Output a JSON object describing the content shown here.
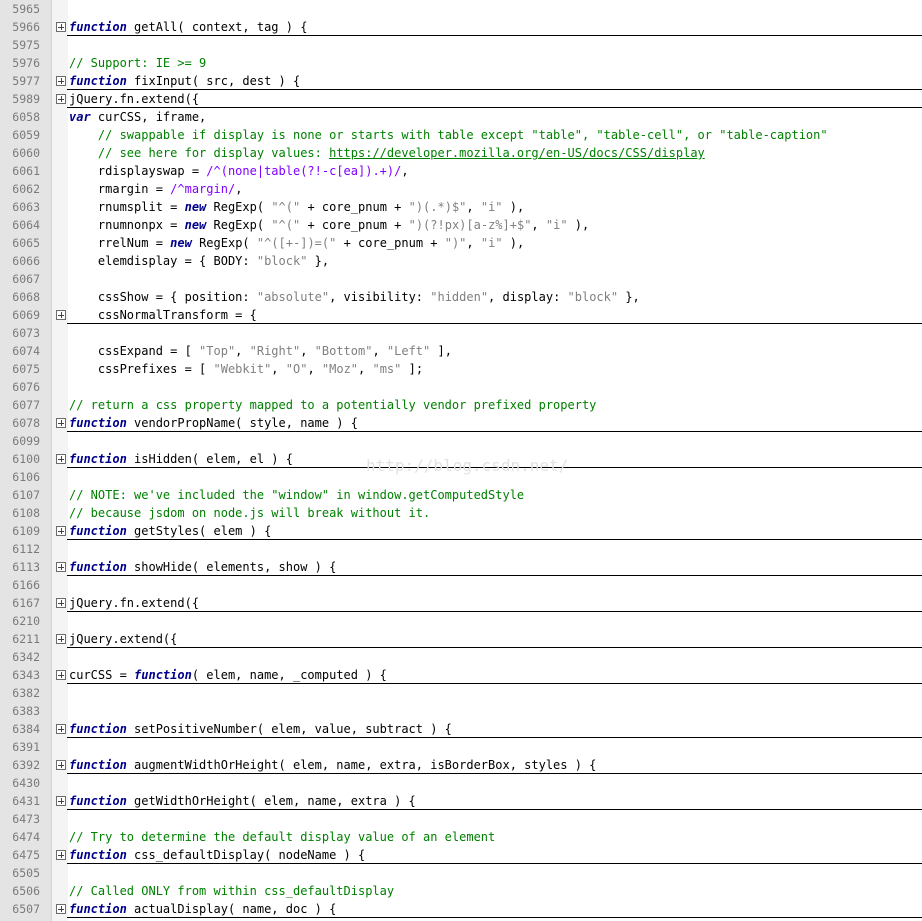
{
  "editor": {
    "watermark": "http://blog.csdn.net/",
    "lines": [
      {
        "n": "5965",
        "fold": false,
        "u": false,
        "code": ""
      },
      {
        "n": "5966",
        "fold": true,
        "u": true,
        "code": "<k>function</k> getAll( context, tag ) {"
      },
      {
        "n": "5975",
        "fold": false,
        "u": false,
        "code": ""
      },
      {
        "n": "5976",
        "fold": false,
        "u": false,
        "code": "<c>// Support: IE >= 9</c>"
      },
      {
        "n": "5977",
        "fold": true,
        "u": true,
        "code": "<k>function</k> fixInput( src, dest ) {"
      },
      {
        "n": "5989",
        "fold": true,
        "u": true,
        "code": "jQuery.fn.extend({"
      },
      {
        "n": "6058",
        "fold": false,
        "u": false,
        "code": "<k>var</k> curCSS, iframe,"
      },
      {
        "n": "6059",
        "fold": false,
        "u": false,
        "code": "    <c>// swappable if display is none or starts with table except \"table\", \"table-cell\", or \"table-caption\"</c>"
      },
      {
        "n": "6060",
        "fold": false,
        "u": false,
        "code": "    <c>// see here for display values: </c><l>https://developer.mozilla.org/en-US/docs/CSS/display</l>"
      },
      {
        "n": "6061",
        "fold": false,
        "u": false,
        "code": "    rdisplayswap = <r>/^(none|table(?!-c[ea]).+)/</r>,"
      },
      {
        "n": "6062",
        "fold": false,
        "u": false,
        "code": "    rmargin = <r>/^margin/</r>,"
      },
      {
        "n": "6063",
        "fold": false,
        "u": false,
        "code": "    rnumsplit = <k>new</k> RegExp( <s>\"^(\"</s> + core_pnum + <s>\")(.*)$\"</s>, <s>\"i\"</s> ),"
      },
      {
        "n": "6064",
        "fold": false,
        "u": false,
        "code": "    rnumnonpx = <k>new</k> RegExp( <s>\"^(\"</s> + core_pnum + <s>\")(?!px)[a-z%]+$\"</s>, <s>\"i\"</s> ),"
      },
      {
        "n": "6065",
        "fold": false,
        "u": false,
        "code": "    rrelNum = <k>new</k> RegExp( <s>\"^([+-])=(\"</s> + core_pnum + <s>\")\"</s>, <s>\"i\"</s> ),"
      },
      {
        "n": "6066",
        "fold": false,
        "u": false,
        "code": "    elemdisplay = { BODY: <s>\"block\"</s> },"
      },
      {
        "n": "6067",
        "fold": false,
        "u": false,
        "code": ""
      },
      {
        "n": "6068",
        "fold": false,
        "u": false,
        "code": "    cssShow = { position: <s>\"absolute\"</s>, visibility: <s>\"hidden\"</s>, display: <s>\"block\"</s> },"
      },
      {
        "n": "6069",
        "fold": true,
        "u": true,
        "code": "    cssNormalTransform = {"
      },
      {
        "n": "6073",
        "fold": false,
        "u": false,
        "code": ""
      },
      {
        "n": "6074",
        "fold": false,
        "u": false,
        "code": "    cssExpand = [ <s>\"Top\"</s>, <s>\"Right\"</s>, <s>\"Bottom\"</s>, <s>\"Left\"</s> ],"
      },
      {
        "n": "6075",
        "fold": false,
        "u": false,
        "code": "    cssPrefixes = [ <s>\"Webkit\"</s>, <s>\"O\"</s>, <s>\"Moz\"</s>, <s>\"ms\"</s> ];"
      },
      {
        "n": "6076",
        "fold": false,
        "u": false,
        "code": ""
      },
      {
        "n": "6077",
        "fold": false,
        "u": false,
        "code": "<c>// return a css property mapped to a potentially vendor prefixed property</c>"
      },
      {
        "n": "6078",
        "fold": true,
        "u": true,
        "code": "<k>function</k> vendorPropName( style, name ) {"
      },
      {
        "n": "6099",
        "fold": false,
        "u": false,
        "code": ""
      },
      {
        "n": "6100",
        "fold": true,
        "u": true,
        "code": "<k>function</k> isHidden( elem, el ) {"
      },
      {
        "n": "6106",
        "fold": false,
        "u": false,
        "code": ""
      },
      {
        "n": "6107",
        "fold": false,
        "u": false,
        "code": "<c>// NOTE: we've included the \"window\" in window.getComputedStyle</c>"
      },
      {
        "n": "6108",
        "fold": false,
        "u": false,
        "code": "<c>// because jsdom on node.js will break without it.</c>"
      },
      {
        "n": "6109",
        "fold": true,
        "u": true,
        "code": "<k>function</k> getStyles( elem ) {"
      },
      {
        "n": "6112",
        "fold": false,
        "u": false,
        "code": ""
      },
      {
        "n": "6113",
        "fold": true,
        "u": true,
        "code": "<k>function</k> showHide( elements, show ) {"
      },
      {
        "n": "6166",
        "fold": false,
        "u": false,
        "code": ""
      },
      {
        "n": "6167",
        "fold": true,
        "u": true,
        "code": "jQuery.fn.extend({"
      },
      {
        "n": "6210",
        "fold": false,
        "u": false,
        "code": ""
      },
      {
        "n": "6211",
        "fold": true,
        "u": true,
        "code": "jQuery.extend({"
      },
      {
        "n": "6342",
        "fold": false,
        "u": false,
        "code": ""
      },
      {
        "n": "6343",
        "fold": true,
        "u": true,
        "code": "curCSS = <k>function</k>( elem, name, _computed ) {"
      },
      {
        "n": "6382",
        "fold": false,
        "u": false,
        "code": ""
      },
      {
        "n": "6383",
        "fold": false,
        "u": false,
        "code": ""
      },
      {
        "n": "6384",
        "fold": true,
        "u": true,
        "code": "<k>function</k> setPositiveNumber( elem, value, subtract ) {"
      },
      {
        "n": "6391",
        "fold": false,
        "u": false,
        "code": ""
      },
      {
        "n": "6392",
        "fold": true,
        "u": true,
        "code": "<k>function</k> augmentWidthOrHeight( elem, name, extra, isBorderBox, styles ) {"
      },
      {
        "n": "6430",
        "fold": false,
        "u": false,
        "code": ""
      },
      {
        "n": "6431",
        "fold": true,
        "u": true,
        "code": "<k>function</k> getWidthOrHeight( elem, name, extra ) {"
      },
      {
        "n": "6473",
        "fold": false,
        "u": false,
        "code": ""
      },
      {
        "n": "6474",
        "fold": false,
        "u": false,
        "code": "<c>// Try to determine the default display value of an element</c>"
      },
      {
        "n": "6475",
        "fold": true,
        "u": true,
        "code": "<k>function</k> css_defaultDisplay( nodeName ) {"
      },
      {
        "n": "6505",
        "fold": false,
        "u": false,
        "code": ""
      },
      {
        "n": "6506",
        "fold": false,
        "u": false,
        "code": "<c>// Called ONLY from within css_defaultDisplay</c>"
      },
      {
        "n": "6507",
        "fold": true,
        "u": true,
        "code": "<k>function</k> actualDisplay( name, doc ) {"
      }
    ]
  }
}
